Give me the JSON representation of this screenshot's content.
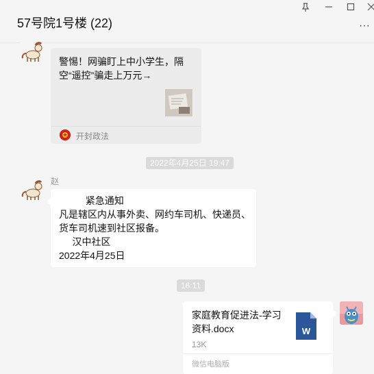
{
  "window": {
    "title": "57号院1号楼 (22)",
    "buttons": {
      "pin": "⊼",
      "minimize": "—",
      "maximize": "☐",
      "close": "✕",
      "more": "···"
    }
  },
  "messages": {
    "link_card": {
      "title": "警惕！网骗盯上中小学生，隔空“遥控”骗走上万元→",
      "source": "开封政法",
      "source_icon": "police-badge-icon"
    },
    "timestamp_1": "2022年4月25日 19:47",
    "text_message": {
      "sender": "赵",
      "lines": [
        "          紧急通知",
        "凡是辖区内从事外卖、网约车司机、快递员、",
        "货车司机速到社区报备。",
        "     汉中社区",
        "2022年4月25日"
      ]
    },
    "timestamp_2": "16:11",
    "file_card": {
      "name": "家庭教育促进法-学习资料.docx",
      "size": "13K",
      "source": "微信电脑版",
      "icon": "word-doc-icon",
      "icon_letter": "W"
    }
  },
  "colors": {
    "background": "#f5f5f5",
    "bubble": "#ffffff",
    "link_card": "#ececec",
    "timestamp_bg": "#dadada",
    "word_blue": "#2b579a",
    "badge_red": "#d0201d"
  }
}
